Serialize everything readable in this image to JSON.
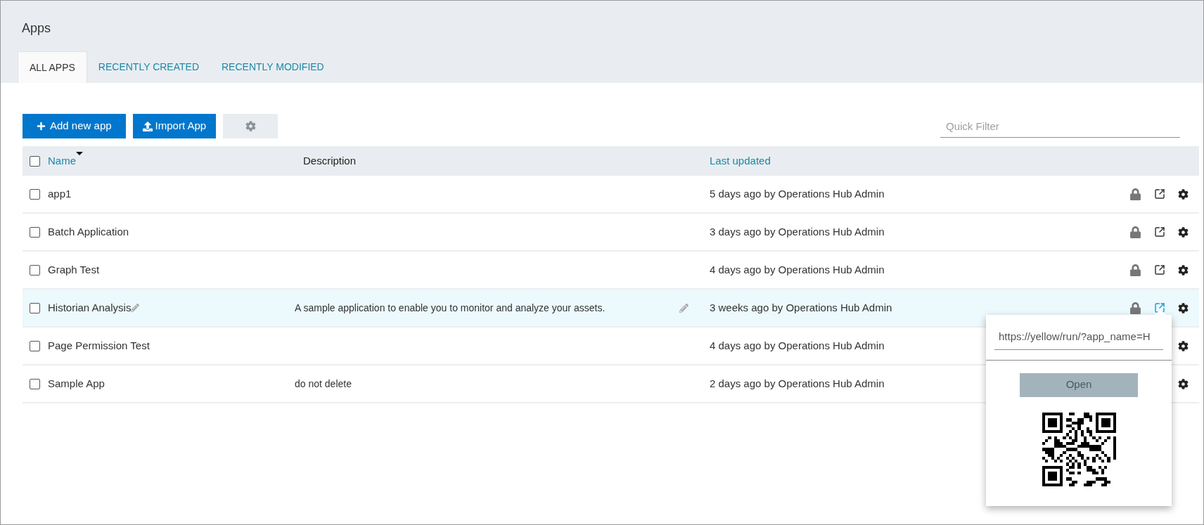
{
  "page": {
    "title": "Apps"
  },
  "tabs": [
    {
      "label": "ALL APPS",
      "selected": true
    },
    {
      "label": "RECENTLY CREATED",
      "selected": false
    },
    {
      "label": "RECENTLY MODIFIED",
      "selected": false
    }
  ],
  "toolbar": {
    "add_button": "Add new app",
    "import_button": "Import App",
    "filter": {
      "placeholder": "Quick Filter"
    }
  },
  "table": {
    "select_all": {
      "checked": false
    },
    "columns": [
      {
        "label": "Name",
        "sortable": true,
        "sorted": true
      },
      {
        "label": "Description",
        "sortable": false,
        "sorted": false
      },
      {
        "label": "Last updated",
        "sortable": true,
        "sorted": false
      }
    ],
    "rows": [
      {
        "name": "app1",
        "updated": "5 days ago by Operations Hub Admin",
        "checked": false,
        "selected": false
      },
      {
        "name": "Batch Application",
        "updated": "3 days ago by Operations Hub Admin",
        "checked": false,
        "selected": false
      },
      {
        "name": "Graph Test",
        "updated": "4 days ago by Operations Hub Admin",
        "checked": false,
        "selected": false
      },
      {
        "name": "Historian Analysis",
        "description": "A sample application to enable you to monitor and analyze your assets.",
        "updated": "3 weeks ago by Operations Hub Admin",
        "checked": false,
        "selected": true
      },
      {
        "name": "Page Permission Test",
        "updated": "4 days ago by Operations Hub Admin",
        "checked": false,
        "selected": false
      },
      {
        "name": "Sample App",
        "description": "do not delete",
        "updated": "2 days ago by Operations Hub Admin",
        "checked": false,
        "selected": false
      }
    ]
  },
  "link_popup": {
    "url": "https://yellow/run/?app_name=H",
    "open_button": "Open"
  }
}
